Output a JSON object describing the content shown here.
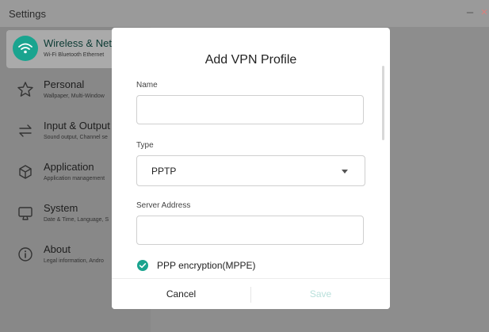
{
  "window": {
    "title": "Settings",
    "minimize": "–",
    "close": "×"
  },
  "sidebar": {
    "items": [
      {
        "title": "Wireless & Netw",
        "subtitle": "Wi-Fi Bluetooth Ethernet",
        "icon": "wifi-icon",
        "active": true
      },
      {
        "title": "Personal",
        "subtitle": "Wallpaper, Multi-Window",
        "icon": "star-icon",
        "active": false
      },
      {
        "title": "Input & Output",
        "subtitle": "Sound output, Channel se",
        "icon": "swap-arrows-icon",
        "active": false
      },
      {
        "title": "Application",
        "subtitle": "Application management",
        "icon": "package-icon",
        "active": false
      },
      {
        "title": "System",
        "subtitle": "Date & Time, Language, S",
        "icon": "monitor-icon",
        "active": false
      },
      {
        "title": "About",
        "subtitle": "Legal information, Andro",
        "icon": "info-icon",
        "active": false
      }
    ]
  },
  "dialog": {
    "title": "Add VPN Profile",
    "name_label": "Name",
    "name_value": "",
    "type_label": "Type",
    "type_value": "PPTP",
    "server_label": "Server Address",
    "server_value": "",
    "ppp_label": "PPP encryption(MPPE)",
    "ppp_checked": true,
    "cancel_label": "Cancel",
    "save_label": "Save"
  },
  "colors": {
    "accent": "#1aa48f",
    "save_disabled": "#b9e0db",
    "close": "#d9807e"
  }
}
